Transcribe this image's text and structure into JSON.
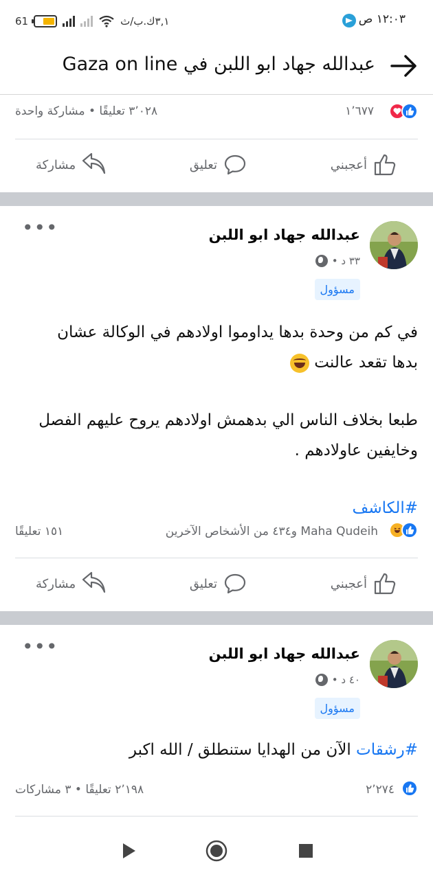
{
  "status_bar": {
    "time": "١٢:٠٣ ص",
    "speed": "٣,١ك.ب/ث",
    "battery": "61",
    "battery_level": 0.61
  },
  "header": {
    "title": "عبدالله جهاد ابو اللبن في Gaza on line"
  },
  "prev_post": {
    "reaction_count": "١٬٦٧٧",
    "stats": "٣٬٠٢٨ تعليقًا • مشاركة واحدة"
  },
  "actions": {
    "like": "أعجبني",
    "comment": "تعليق",
    "share": "مشاركة"
  },
  "posts": [
    {
      "author": "عبدالله جهاد ابو اللبن",
      "time": "٣٣ د •",
      "badge": "مسؤول",
      "line1": "في كم من وحدة بدها يداوموا اولادهم في الوكالة عشان",
      "line2": "بدها تقعد عالنت",
      "line3": "طبعا بخلاف الناس الي بدهمش اولادهم يروح عليهم الفصل",
      "line4": "وخايفين عاولادهم .",
      "hashtag": "#الكاشف",
      "reactions_text": "Maha Qudeih و٤٣٤ من الأشخاص الآخرين",
      "comments": "١٥١ تعليقًا"
    },
    {
      "author": "عبدالله جهاد ابو اللبن",
      "time": "٤٠ د •",
      "badge": "مسؤول",
      "hashtag": "#رشقات",
      "text": " الآن من الهدايا ستنطلق / الله اكبر",
      "reaction_count": "٢٬٢٧٤",
      "stats": "٢٬١٩٨ تعليقًا • ٣ مشاركات"
    }
  ],
  "icons": {
    "like": "thumbs-up-icon",
    "comment": "comment-bubble-icon",
    "share": "share-arrow-icon",
    "back": "arrow-right-icon"
  },
  "colors": {
    "accent": "#1877f2",
    "love": "#f02849",
    "haha": "#f7b125",
    "divider": "#c9ccd1"
  }
}
